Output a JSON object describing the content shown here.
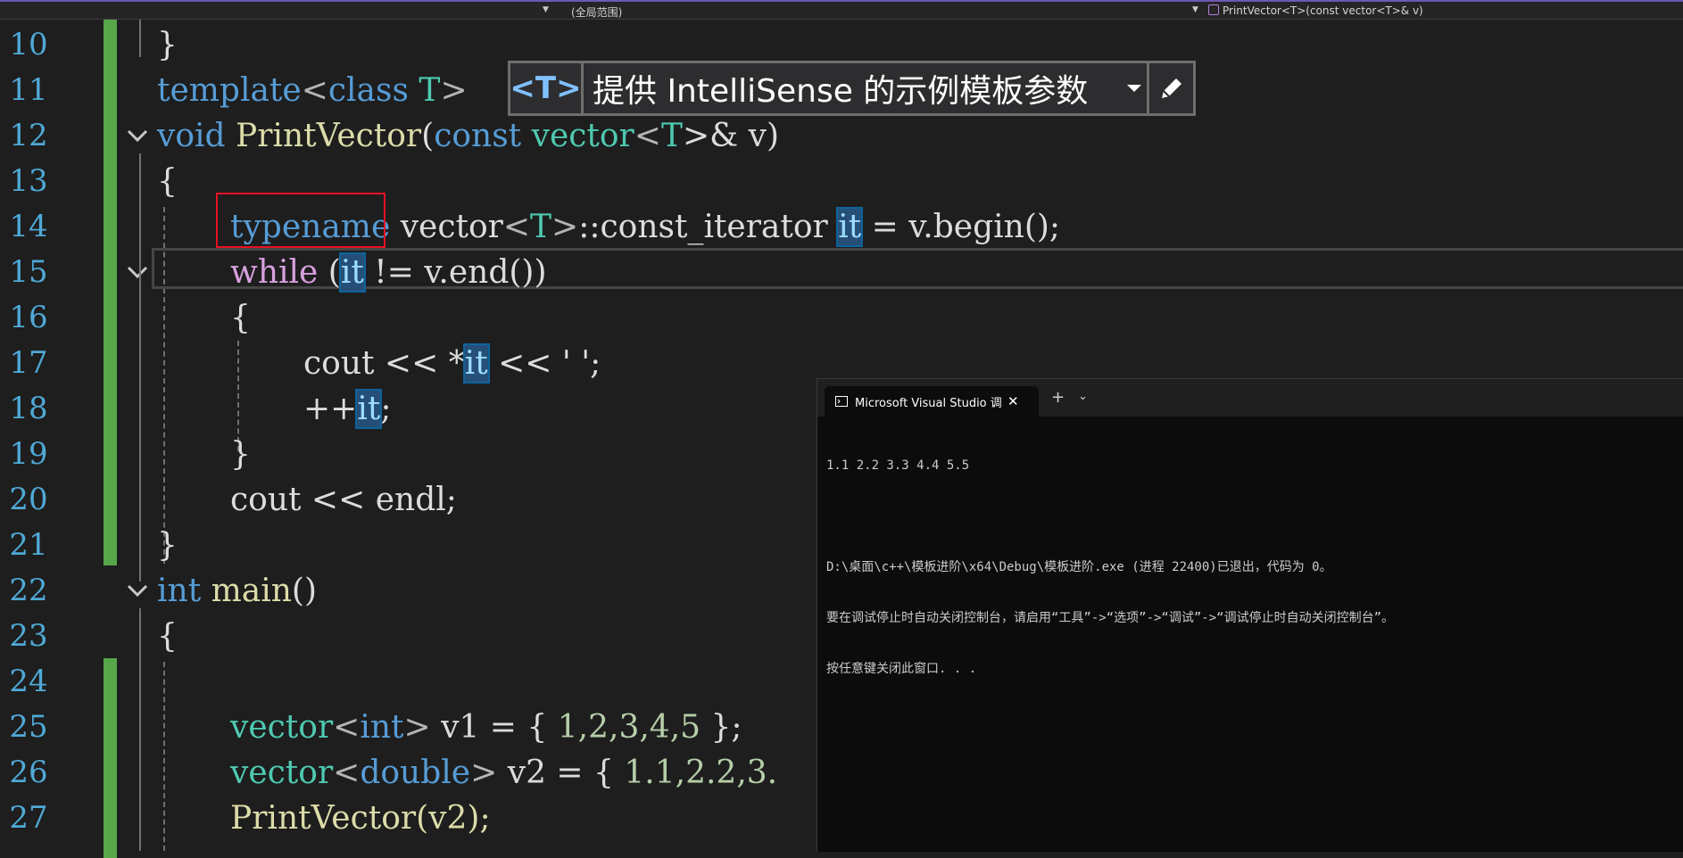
{
  "navbar": {
    "scope": "(全局范围)",
    "function": "PrintVector<T>(const vector<T>& v)"
  },
  "line_numbers": [
    "10",
    "11",
    "12",
    "13",
    "14",
    "15",
    "16",
    "17",
    "18",
    "19",
    "20",
    "21",
    "22",
    "23",
    "24",
    "25",
    "26",
    "27"
  ],
  "code": {
    "l10_brace": "}",
    "l11_template": "template",
    "l11_lt": "<",
    "l11_class": "class",
    "l11_T": " T",
    "l11_gt": ">",
    "l12_void": "void",
    "l12_fn": " PrintVector",
    "l12_paren": "(",
    "l12_const": "const",
    "l12_vector": " vector",
    "l12_lt": "<",
    "l12_T": "T",
    "l12_rest": ">& v)",
    "l13_brace": "{",
    "l14_typename": "typename",
    "l14_vector": " vector",
    "l14_lt": "<",
    "l14_T": "T",
    "l14_gt": ">",
    "l14_iter": "::const_iterator ",
    "l14_it": "it",
    "l14_rest": " = v.begin();",
    "l15_while": "while",
    "l15_open": " (",
    "l15_it": "it",
    "l15_rest": " != v.end())",
    "l16_brace": "{",
    "l17_cout": "cout << *",
    "l17_it": "it",
    "l17_rest": " << ' ';",
    "l18_pp": "++",
    "l18_it": "it",
    "l18_semi": ";",
    "l19_brace": "}",
    "l20_cout": "cout << endl;",
    "l21_brace": "}",
    "l22_int": "int",
    "l22_main": " main",
    "l22_paren": "()",
    "l23_brace": "{",
    "l25_vector": "vector",
    "l25_lt": "<",
    "l25_int": "int",
    "l25_gt": ">",
    "l25_v1": " v1 = { ",
    "l25_nums": "1,2,3,4,5",
    "l25_end": " };",
    "l26_vector": "vector",
    "l26_lt": "<",
    "l26_double": "double",
    "l26_gt": ">",
    "l26_v2": " v2 = { ",
    "l26_nums": "1.1,2.2,3.",
    "l27_call": "PrintVector(v2);"
  },
  "intellisense": {
    "param": "<T>",
    "text": "提供 IntelliSense 的示例模板参数"
  },
  "terminal": {
    "tab_title": "Microsoft Visual Studio 调试控制台",
    "close": "✕",
    "plus": "+",
    "chevron": "⌄",
    "lines": [
      "1.1 2.2 3.3 4.4 5.5",
      "",
      "D:\\桌面\\c++\\模板进阶\\x64\\Debug\\模板进阶.exe (进程 22400)已退出，代码为 0。",
      "要在调试停止时自动关闭控制台，请启用“工具”->“选项”->“调试”->“调试停止时自动关闭控制台”。",
      "按任意键关闭此窗口. . ."
    ]
  },
  "colors": {
    "keyword": "#569cd6",
    "control": "#d8a0df",
    "type": "#4ec9b0",
    "function": "#dcdcaa",
    "number": "#b5cea8",
    "change_bar": "#57a64a",
    "red_box": "#e81123"
  }
}
